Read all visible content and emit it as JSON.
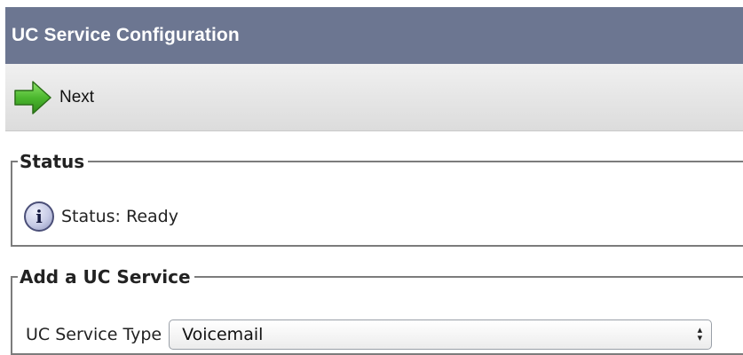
{
  "header": {
    "title": "UC Service Configuration"
  },
  "toolbar": {
    "next_label": "Next",
    "next_icon": "green-right-arrow-icon"
  },
  "status_section": {
    "legend": "Status",
    "icon": "info-icon",
    "text": "Status: Ready"
  },
  "service_section": {
    "legend": "Add a UC Service",
    "type_label": "UC Service Type",
    "type_value": "Voicemail"
  },
  "colors": {
    "titlebar_bg": "#6c7691",
    "arrow_green": "#4cb82f"
  }
}
